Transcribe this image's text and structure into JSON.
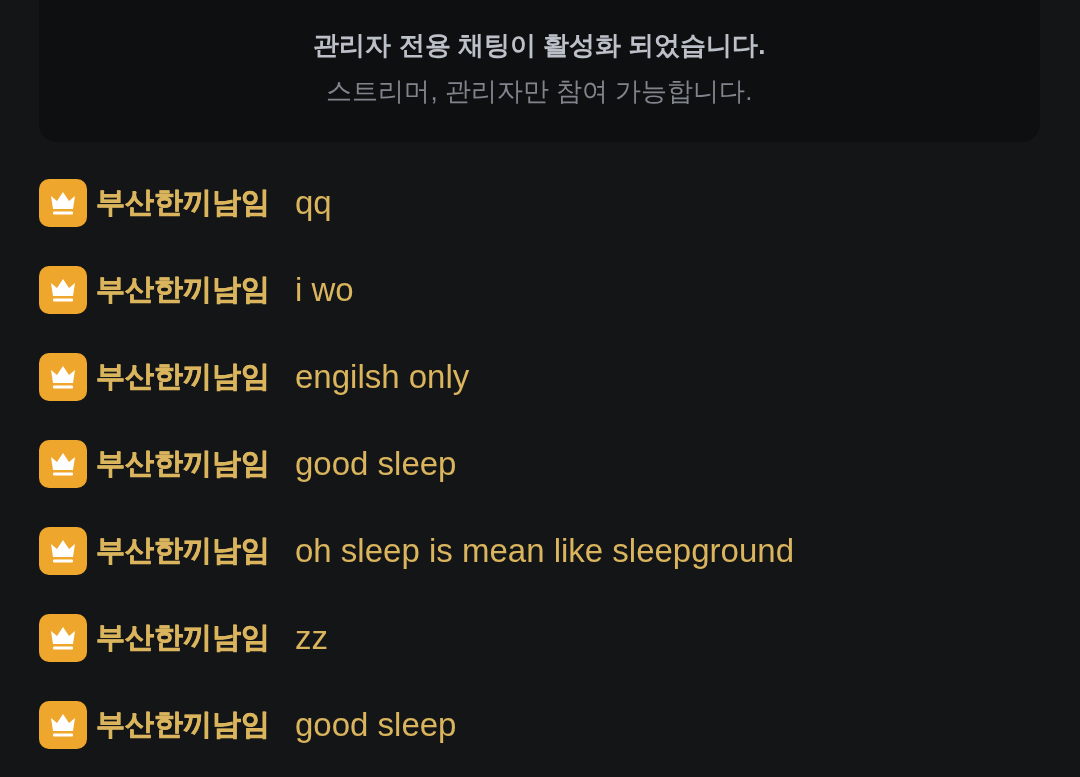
{
  "notice": {
    "title": "관리자 전용 채팅이 활성화 되었습니다.",
    "subtitle": "스트리머, 관리자만 참여 가능합니다."
  },
  "messages": [
    {
      "username": "부산한끼남임",
      "text": "qq"
    },
    {
      "username": "부산한끼남임",
      "text": "i wo"
    },
    {
      "username": "부산한끼남임",
      "text": "engilsh only"
    },
    {
      "username": "부산한끼남임",
      "text": "good sleep"
    },
    {
      "username": "부산한끼남임",
      "text": "oh sleep is mean like sleepground"
    },
    {
      "username": "부산한끼남임",
      "text": "zz"
    },
    {
      "username": "부산한끼남임",
      "text": "good sleep"
    }
  ]
}
